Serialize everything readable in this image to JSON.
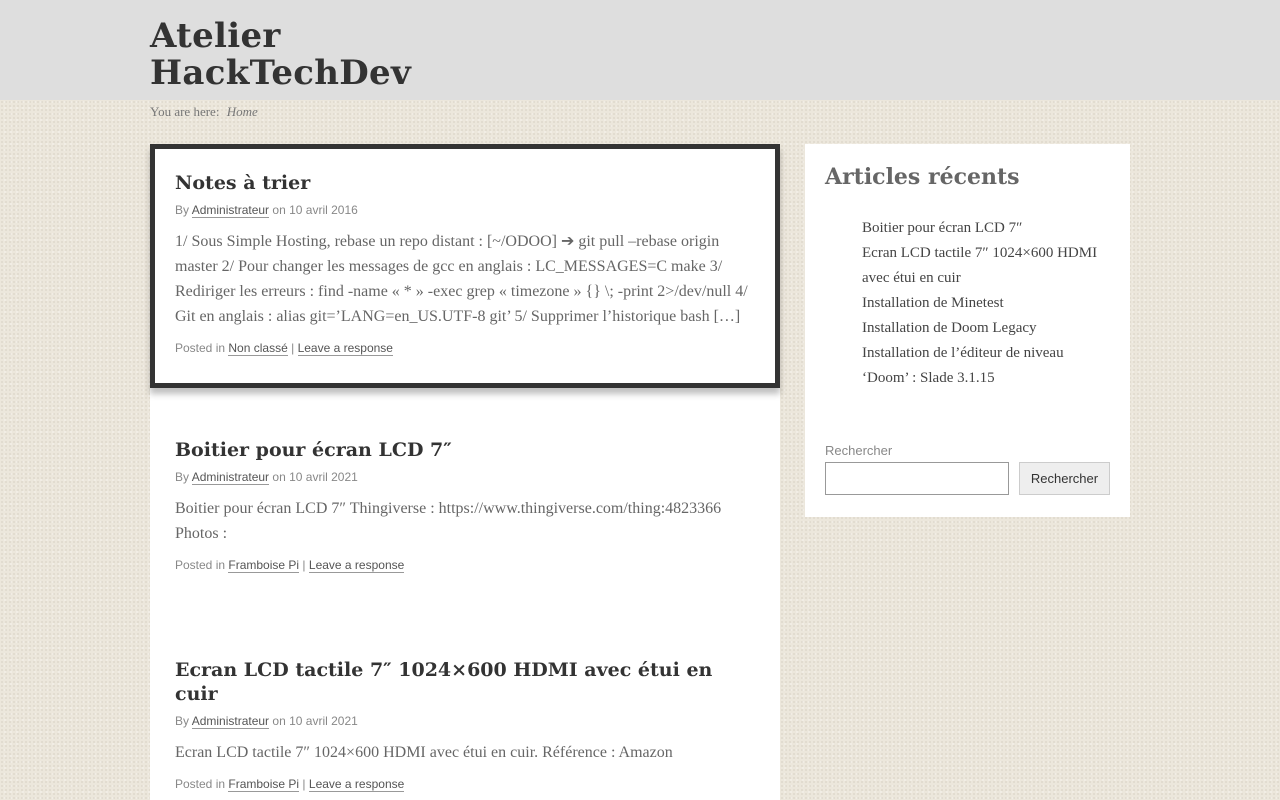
{
  "site": {
    "title": "Atelier HackTechDev"
  },
  "breadcrumb": {
    "prefix": "You are here:",
    "home": "Home"
  },
  "posts": [
    {
      "title": "Notes à trier",
      "by": "By",
      "author": "Administrateur",
      "on": "on",
      "date": "10 avril 2016",
      "excerpt": "1/ Sous Simple Hosting, rebase un repo distant : [~/ODOO] ➔ git pull –rebase origin master 2/ Pour changer les messages de gcc en anglais : LC_MESSAGES=C make 3/ Rediriger les erreurs : find -name « * » -exec grep « timezone » {} \\; -print 2>/dev/null 4/ Git en anglais : alias git=’LANG=en_US.UTF-8 git’ 5/ Supprimer l’historique bash […]",
      "posted_in": "Posted in",
      "category": "Non classé",
      "separator": "|",
      "response": "Leave a response"
    },
    {
      "title": "Boitier pour écran LCD 7″",
      "by": "By",
      "author": "Administrateur",
      "on": "on",
      "date": "10 avril 2021",
      "excerpt": "Boitier pour écran LCD 7″ Thingiverse : https://www.thingiverse.com/thing:4823366 Photos :",
      "posted_in": "Posted in",
      "category": "Framboise Pi",
      "separator": "|",
      "response": "Leave a response"
    },
    {
      "title": "Ecran LCD tactile 7″ 1024×600 HDMI avec étui en cuir",
      "by": "By",
      "author": "Administrateur",
      "on": "on",
      "date": "10 avril 2021",
      "excerpt": "Ecran LCD tactile 7″ 1024×600 HDMI avec étui en cuir. Référence : Amazon",
      "posted_in": "Posted in",
      "category": "Framboise Pi",
      "separator": "|",
      "response": "Leave a response"
    }
  ],
  "sidebar": {
    "recent_title": "Articles récents",
    "recent": [
      "Boitier pour écran LCD 7″",
      "Ecran LCD tactile 7″ 1024×600 HDMI avec étui en cuir",
      "Installation de Minetest",
      "Installation de Doom Legacy",
      "Installation de l’éditeur de niveau ‘Doom’ : Slade 3.1.15"
    ],
    "search_label": "Rechercher",
    "search_button": "Rechercher"
  }
}
